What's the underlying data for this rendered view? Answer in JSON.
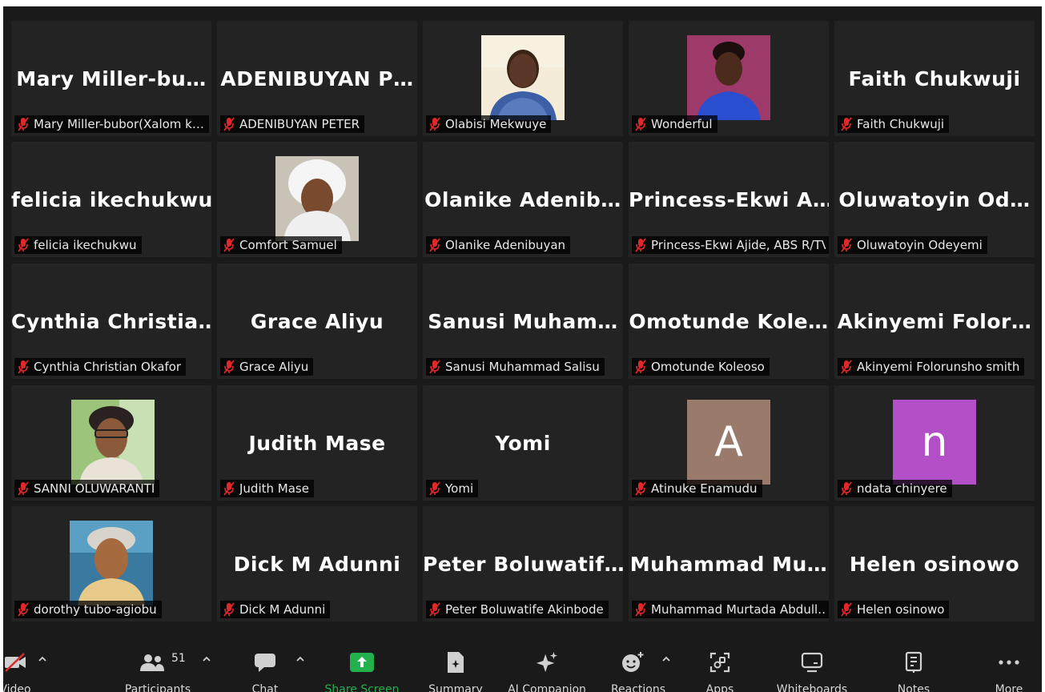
{
  "tiles": [
    {
      "big": "Mary Miller-bu…",
      "label": "Mary Miller-bubor(Xalom k…",
      "kind": "name"
    },
    {
      "big": "ADENIBUYAN P…",
      "label": "ADENIBUYAN PETER",
      "kind": "name"
    },
    {
      "big": "",
      "label": "Olabisi Mekwuye",
      "kind": "photo",
      "photo": "olabisi"
    },
    {
      "big": "",
      "label": "Wonderful",
      "kind": "photo",
      "photo": "wonderful"
    },
    {
      "big": "Faith Chukwuji",
      "label": "Faith Chukwuji",
      "kind": "name"
    },
    {
      "big": "felicia ikechukwu",
      "label": "felicia ikechukwu",
      "kind": "name"
    },
    {
      "big": "",
      "label": "Comfort Samuel",
      "kind": "photo",
      "photo": "comfort"
    },
    {
      "big": "Olanike Adenib…",
      "label": "Olanike Adenibuyan",
      "kind": "name"
    },
    {
      "big": "Princess-Ekwi A…",
      "label": "Princess-Ekwi Ajide, ABS R/TV",
      "kind": "name"
    },
    {
      "big": "Oluwatoyin Od…",
      "label": "Oluwatoyin Odeyemi",
      "kind": "name"
    },
    {
      "big": "Cynthia Christia…",
      "label": "Cynthia Christian Okafor",
      "kind": "name"
    },
    {
      "big": "Grace Aliyu",
      "label": "Grace Aliyu",
      "kind": "name"
    },
    {
      "big": "Sanusi Muham…",
      "label": "Sanusi Muhammad Salisu",
      "kind": "name"
    },
    {
      "big": "Omotunde Kole…",
      "label": "Omotunde Koleoso",
      "kind": "name"
    },
    {
      "big": "Akinyemi Folor…",
      "label": "Akinyemi Folorunsho smith",
      "kind": "name"
    },
    {
      "big": "",
      "label": "SANNI OLUWARANTI",
      "kind": "photo",
      "photo": "sanni"
    },
    {
      "big": "Judith Mase",
      "label": "Judith Mase",
      "kind": "name"
    },
    {
      "big": "Yomi",
      "label": "Yomi",
      "kind": "name"
    },
    {
      "big": "A",
      "label": "Atinuke Enamudu",
      "kind": "letter",
      "color": "#9a7a6b"
    },
    {
      "big": "n",
      "label": "ndata chinyere",
      "kind": "letter",
      "color": "#b34fc7"
    },
    {
      "big": "",
      "label": "dorothy tubo-agiobu",
      "kind": "photo",
      "photo": "dorothy"
    },
    {
      "big": "Dick M Adunni",
      "label": "Dick M Adunni",
      "kind": "name"
    },
    {
      "big": "Peter Boluwatif…",
      "label": "Peter Boluwatife Akinbode",
      "kind": "name"
    },
    {
      "big": "Muhammad Mu…",
      "label": "Muhammad Murtada Abdull…",
      "kind": "name"
    },
    {
      "big": "Helen osinowo",
      "label": "Helen osinowo",
      "kind": "name"
    }
  ],
  "toolbar": {
    "video": "Video",
    "participants": "Participants",
    "participants_count": "51",
    "chat": "Chat",
    "share_screen": "Share Screen",
    "summary": "Summary",
    "ai_companion": "AI Companion",
    "reactions": "Reactions",
    "apps": "Apps",
    "whiteboards": "Whiteboards",
    "notes": "Notes",
    "more": "More"
  },
  "colors": {
    "background": "#1a1a1a",
    "tile": "#232323",
    "mute_red": "#e02828",
    "share_green": "#22b14c"
  }
}
